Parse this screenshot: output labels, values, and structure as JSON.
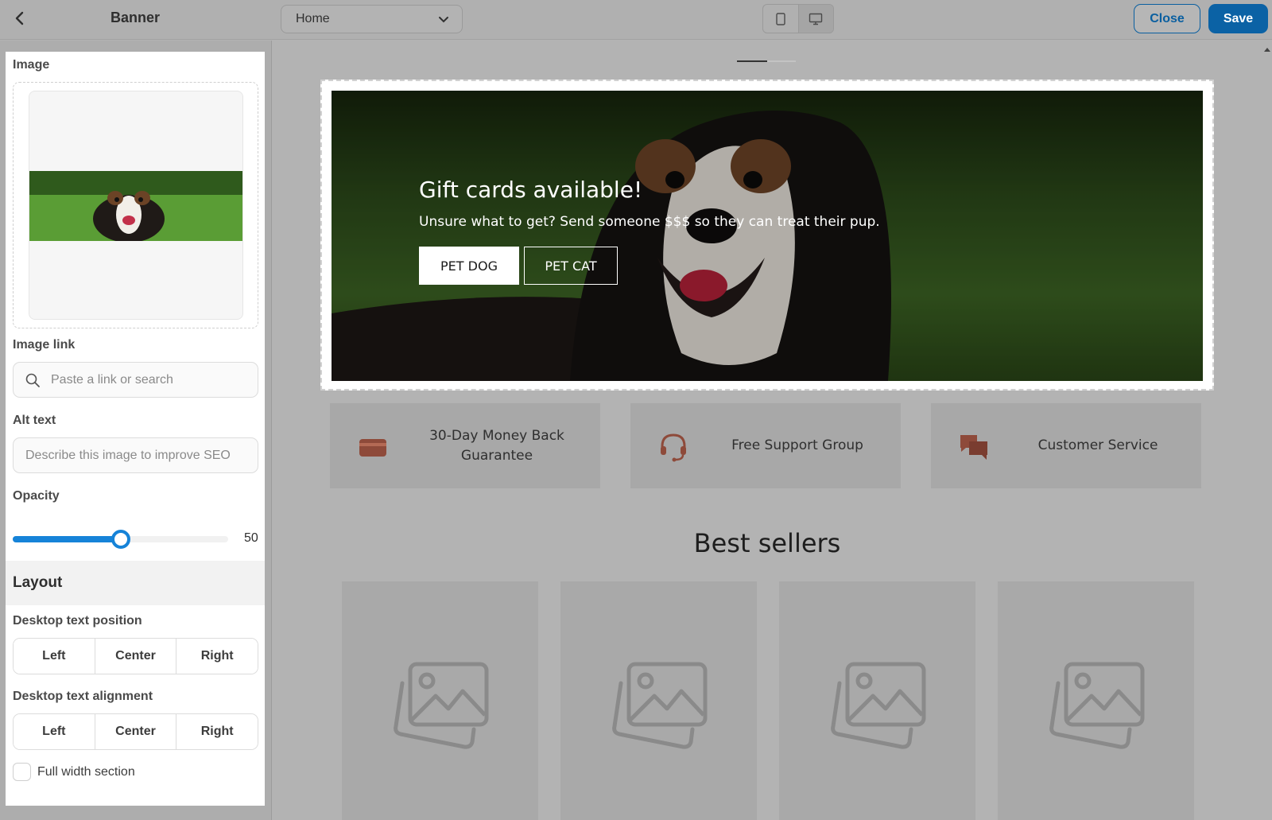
{
  "header": {
    "panel_title": "Banner",
    "page_select": "Home",
    "close_label": "Close",
    "save_label": "Save"
  },
  "sidebar": {
    "image_label": "Image",
    "image_link_label": "Image link",
    "image_link_placeholder": "Paste a link or search",
    "alt_text_label": "Alt text",
    "alt_text_placeholder": "Describe this image to improve SEO",
    "opacity_label": "Opacity",
    "opacity_value": "50",
    "opacity_fraction": 0.5,
    "layout_heading": "Layout",
    "desktop_text_position_label": "Desktop text position",
    "position_options": [
      "Left",
      "Center",
      "Right"
    ],
    "desktop_text_alignment_label": "Desktop text alignment",
    "alignment_options": [
      "Left",
      "Center",
      "Right"
    ],
    "full_width_label": "Full width section"
  },
  "banner": {
    "title": "Gift cards available!",
    "subtitle": "Unsure what to get? Send someone $$$ so they can treat their pup.",
    "button1": "PET DOG",
    "button2": "PET CAT"
  },
  "features": [
    {
      "icon": "credit-card-icon",
      "text": "30-Day Money Back Guarantee"
    },
    {
      "icon": "headset-icon",
      "text": "Free Support Group"
    },
    {
      "icon": "chat-bubbles-icon",
      "text": "Customer Service"
    }
  ],
  "best_sellers_title": "Best sellers",
  "colors": {
    "accent_blue": "#0b62a5",
    "slider_blue": "#1683d8",
    "feature_icon": "#8e4a3a"
  }
}
